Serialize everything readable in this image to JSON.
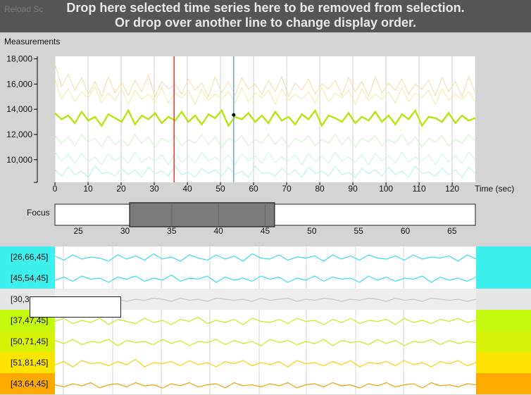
{
  "banner": {
    "line1": "Drop here selected time series here to be removed from selection.",
    "line2": "Or drop over another line to change display order.",
    "underlay": "Reload Sc"
  },
  "chart_data": {
    "type": "line",
    "ylabel": "Measurements",
    "xlabel": "Time (sec)",
    "xlim": [
      0,
      127
    ],
    "ylim": [
      8200,
      18200
    ],
    "yticks": [
      10000,
      12000,
      14000,
      16000,
      18000
    ],
    "ytick_labels": [
      "10,000",
      "12,000",
      "14,000",
      "16,000",
      "18,000"
    ],
    "xticks": [
      0,
      10,
      20,
      30,
      40,
      50,
      60,
      70,
      80,
      90,
      100,
      110,
      120
    ],
    "grid": "vertical",
    "markers": {
      "red_line_x": 36,
      "blue_line_x": 54,
      "point": {
        "x": 54,
        "y": 13550
      }
    },
    "series": [
      {
        "color": "#f5d9a8",
        "values": [
          17600,
          15800,
          16800,
          15500,
          16500,
          15200,
          16200,
          15000,
          16600,
          15300,
          16100,
          15100,
          16300,
          15400,
          16700,
          15000,
          16200,
          15600,
          16000,
          15200,
          16400,
          15500,
          16100,
          15000,
          16600,
          15300,
          16200,
          15100,
          16500,
          15600,
          16000,
          15200,
          16300,
          15400,
          16600,
          15000,
          16100,
          15500,
          16400,
          15200,
          16000,
          15600,
          16300,
          15100,
          16500,
          15400,
          16200,
          15000,
          16600,
          15300,
          16100,
          15500,
          16400,
          15200,
          16000,
          15600,
          16300,
          15100,
          16500,
          15400,
          16200,
          15000,
          16600,
          15300
        ]
      },
      {
        "color": "#f7e6a6",
        "values": [
          16400,
          14800,
          15600,
          14600,
          15400,
          14900,
          15800,
          14500,
          15300,
          14700,
          15600,
          14400,
          15500,
          14800,
          15200,
          14600,
          15700,
          14500,
          15300,
          14900,
          15500,
          14400,
          15600,
          14700,
          15200,
          14800,
          15400,
          14500,
          15700,
          14600,
          15300,
          14900,
          15500,
          14400,
          15600,
          14700,
          15200,
          14800,
          15400,
          14500,
          15700,
          14600,
          15300,
          14900,
          15500,
          14400,
          15600,
          14700,
          15200,
          14800,
          15400,
          14500,
          15700,
          14600,
          15300,
          14900,
          15500,
          14400,
          15600,
          14700,
          15200,
          14800,
          15400,
          14600
        ]
      },
      {
        "color": "#b8e51a",
        "values": [
          13700,
          13200,
          13500,
          12900,
          13800,
          13100,
          13400,
          12700,
          13600,
          13300,
          13000,
          13900,
          12800,
          13500,
          13200,
          13700,
          12900,
          13400,
          13100,
          13800,
          13000,
          13500,
          12800,
          13600,
          13300,
          13900,
          12700,
          13400,
          13200,
          13700,
          13000,
          13500,
          12900,
          13800,
          13100,
          13400,
          12800,
          13600,
          13200,
          13900,
          12700,
          13500,
          13300,
          13000,
          13700,
          12900,
          13400,
          13100,
          13800,
          13000,
          13500,
          12800,
          13600,
          13200,
          13900,
          12700,
          13400,
          13300,
          13000,
          13700,
          12900,
          13500,
          13100,
          13300
        ]
      },
      {
        "color": "#cff0cc",
        "values": [
          11900,
          11300,
          11800,
          11100,
          12000,
          11400,
          11700,
          11000,
          11900,
          11200,
          11600,
          11100,
          12000,
          11300,
          11800,
          11000,
          11700,
          11400,
          11900,
          11100,
          11600,
          11300,
          12000,
          11200,
          11800,
          11000,
          11700,
          11400,
          11900,
          11100,
          11600,
          11300,
          12000,
          11200,
          11800,
          11000,
          11700,
          11400,
          11900,
          11100,
          11600,
          11300,
          12000,
          11200,
          11800,
          11000,
          11700,
          11400,
          11900,
          11100,
          11600,
          11300,
          12000,
          11200,
          11800,
          11000,
          11700,
          11400,
          11900,
          11100,
          11600,
          11300,
          12000,
          11500
        ]
      },
      {
        "color": "#c6f3ef",
        "values": [
          10600,
          9900,
          10400,
          9700,
          10500,
          9800,
          10200,
          9600,
          10500,
          9900,
          10300,
          9700,
          10600,
          9800,
          10200,
          9900,
          10400,
          9600,
          10500,
          9800,
          10300,
          9700,
          10600,
          9900,
          10200,
          9800,
          10400,
          9600,
          10500,
          9900,
          10300,
          9700,
          10600,
          9800,
          10200,
          9900,
          10400,
          9600,
          10500,
          9800,
          10300,
          9700,
          10600,
          9900,
          10200,
          9800,
          10400,
          9600,
          10500,
          9900,
          10300,
          9700,
          10600,
          9800,
          10200,
          9900,
          10400,
          9600,
          10500,
          9800,
          10300,
          9700,
          10600,
          10000
        ]
      },
      {
        "color": "#aef0ef",
        "values": [
          9200,
          8700,
          9400,
          8800,
          9100,
          8600,
          9500,
          8900,
          9000,
          8700,
          9300,
          8800,
          9200,
          8600,
          9400,
          8900,
          9100,
          8700,
          9500,
          8800,
          9000,
          8600,
          9300,
          8900,
          9200,
          8700,
          9400,
          8800,
          9100,
          8600,
          9500,
          8900,
          9000,
          8700,
          9300,
          8800,
          9200,
          8600,
          9400,
          8900,
          9100,
          8700,
          9500,
          8800,
          9000,
          8600,
          9300,
          8900,
          9200,
          8700,
          9400,
          8800,
          9100,
          8600,
          9500,
          8900,
          9000,
          8700,
          9300,
          8800,
          9200,
          8600,
          9400,
          8900
        ]
      }
    ]
  },
  "focus": {
    "label": "Focus",
    "range": [
      22.5,
      67.5
    ],
    "selection": [
      30.5,
      46
    ],
    "ticks": [
      25,
      30,
      35,
      40,
      45,
      50,
      55,
      60,
      65
    ]
  },
  "small_multiples": [
    {
      "label": "[26,66,45]",
      "bg": "#3df0ee",
      "line": "#38dfe9",
      "values": [
        0.55,
        0.35,
        0.6,
        0.4,
        0.5,
        0.45,
        0.3,
        0.6,
        0.4,
        0.55,
        0.35,
        0.65,
        0.4,
        0.5,
        0.3,
        0.6,
        0.45,
        0.35,
        0.6,
        0.4,
        0.55,
        0.3,
        0.65,
        0.45,
        0.4,
        0.6,
        0.35,
        0.5,
        0.45,
        0.55,
        0.3,
        0.6,
        0.4,
        0.55,
        0.35,
        0.6,
        0.45,
        0.4,
        0.55,
        0.35,
        0.6,
        0.4,
        0.5,
        0.45,
        0.55,
        0.3,
        0.6,
        0.4
      ]
    },
    {
      "label": "[45,54,45]",
      "bg": "#3df0ee",
      "line": "#38dfe9",
      "values": [
        0.4,
        0.55,
        0.35,
        0.6,
        0.45,
        0.5,
        0.3,
        0.55,
        0.45,
        0.6,
        0.35,
        0.5,
        0.4,
        0.65,
        0.35,
        0.5,
        0.45,
        0.6,
        0.3,
        0.55,
        0.4,
        0.5,
        0.35,
        0.6,
        0.45,
        0.55,
        0.3,
        0.5,
        0.4,
        0.6,
        0.35,
        0.55,
        0.45,
        0.5,
        0.3,
        0.6,
        0.4,
        0.55,
        0.35,
        0.5,
        0.45,
        0.6,
        0.3,
        0.55,
        0.4,
        0.5,
        0.35,
        0.55
      ]
    },
    {
      "label": "[30,3",
      "bg": "#e6e6e6",
      "line": "#c8c8c8",
      "values": [
        0.5,
        0.45,
        0.55,
        0.4,
        0.5,
        0.45,
        0.55,
        0.5,
        0.4,
        0.5,
        0.45,
        0.55,
        0.5,
        0.4,
        0.55,
        0.45,
        0.5,
        0.4,
        0.55,
        0.5,
        0.45,
        0.5,
        0.4,
        0.55,
        0.45,
        0.5,
        0.55,
        0.4,
        0.5,
        0.45,
        0.55,
        0.5,
        0.4,
        0.5,
        0.45,
        0.55,
        0.5,
        0.4,
        0.55,
        0.45,
        0.5,
        0.4,
        0.55,
        0.5,
        0.45,
        0.5,
        0.4,
        0.5
      ]
    },
    {
      "label": "[37,47,45]",
      "bg": "#c5fa10",
      "line": "#c1ef20",
      "values": [
        0.45,
        0.6,
        0.35,
        0.5,
        0.4,
        0.6,
        0.3,
        0.55,
        0.45,
        0.35,
        0.6,
        0.4,
        0.5,
        0.3,
        0.55,
        0.45,
        0.65,
        0.35,
        0.5,
        0.4,
        0.55,
        0.3,
        0.6,
        0.45,
        0.4,
        0.55,
        0.35,
        0.6,
        0.45,
        0.5,
        0.3,
        0.55,
        0.4,
        0.6,
        0.35,
        0.5,
        0.45,
        0.55,
        0.3,
        0.6,
        0.4,
        0.5,
        0.35,
        0.55,
        0.45,
        0.6,
        0.4,
        0.5
      ]
    },
    {
      "label": "[50,71,45]",
      "bg": "#d4f306",
      "line": "#d2e51e",
      "values": [
        0.55,
        0.4,
        0.6,
        0.35,
        0.5,
        0.45,
        0.6,
        0.3,
        0.55,
        0.45,
        0.5,
        0.35,
        0.6,
        0.4,
        0.55,
        0.3,
        0.5,
        0.45,
        0.6,
        0.35,
        0.55,
        0.4,
        0.5,
        0.3,
        0.6,
        0.45,
        0.55,
        0.35,
        0.5,
        0.4,
        0.6,
        0.3,
        0.55,
        0.45,
        0.5,
        0.35,
        0.6,
        0.4,
        0.55,
        0.3,
        0.5,
        0.45,
        0.6,
        0.35,
        0.55,
        0.4,
        0.5,
        0.45
      ]
    },
    {
      "label": "[51,81,45]",
      "bg": "#fde300",
      "line": "#f5d40c",
      "values": [
        0.4,
        0.55,
        0.3,
        0.6,
        0.45,
        0.5,
        0.35,
        0.55,
        0.4,
        0.65,
        0.3,
        0.5,
        0.45,
        0.55,
        0.35,
        0.6,
        0.4,
        0.5,
        0.3,
        0.55,
        0.45,
        0.6,
        0.35,
        0.5,
        0.4,
        0.55,
        0.3,
        0.6,
        0.45,
        0.5,
        0.35,
        0.55,
        0.4,
        0.6,
        0.3,
        0.5,
        0.45,
        0.55,
        0.35,
        0.6,
        0.4,
        0.5,
        0.3,
        0.55,
        0.45,
        0.6,
        0.35,
        0.5
      ]
    },
    {
      "label": "[43,64,45]",
      "bg": "#fda900",
      "line": "#f2a20a",
      "values": [
        0.45,
        0.35,
        0.5,
        0.4,
        0.55,
        0.3,
        0.45,
        0.5,
        0.35,
        0.55,
        0.4,
        0.45,
        0.3,
        0.5,
        0.4,
        0.55,
        0.35,
        0.45,
        0.5,
        0.3,
        0.55,
        0.4,
        0.45,
        0.35,
        0.5,
        0.4,
        0.55,
        0.3,
        0.45,
        0.5,
        0.35,
        0.55,
        0.4,
        0.45,
        0.3,
        0.5,
        0.4,
        0.55,
        0.35,
        0.45,
        0.5,
        0.3,
        0.55,
        0.4,
        0.45,
        0.35,
        0.5,
        0.45
      ]
    }
  ]
}
